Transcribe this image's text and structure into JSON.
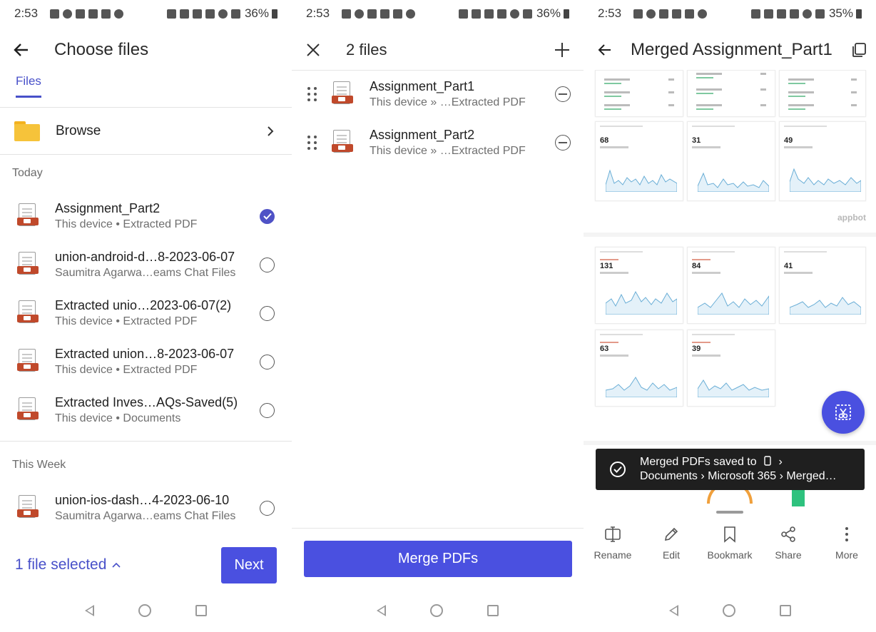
{
  "screen1": {
    "status": {
      "time": "2:53",
      "battery": "36%"
    },
    "title": "Choose files",
    "tab_files": "Files",
    "browse_label": "Browse",
    "section_today": "Today",
    "section_week": "This Week",
    "files": [
      {
        "name": "Assignment_Part2",
        "sub": "This device • Extracted PDF",
        "checked": true
      },
      {
        "name": "union-android-d…8-2023-06-07",
        "sub": "Saumitra Agarwa…eams Chat Files",
        "checked": false
      },
      {
        "name": "Extracted unio…2023-06-07(2)",
        "sub": "This device • Extracted PDF",
        "checked": false
      },
      {
        "name": "Extracted union…8-2023-06-07",
        "sub": "This device • Extracted PDF",
        "checked": false
      },
      {
        "name": "Extracted Inves…AQs-Saved(5)",
        "sub": "This device • Documents",
        "checked": false
      },
      {
        "name": "union-ios-dash…4-2023-06-10",
        "sub": "Saumitra Agarwa…eams Chat Files",
        "checked": false
      }
    ],
    "selected_text": "1 file selected",
    "next_label": "Next"
  },
  "screen2": {
    "status": {
      "time": "2:53",
      "battery": "36%"
    },
    "title": "2 files",
    "files": [
      {
        "name": "Assignment_Part1",
        "sub": "This device » …Extracted PDF"
      },
      {
        "name": "Assignment_Part2",
        "sub": "This device » …Extracted PDF"
      }
    ],
    "merge_label": "Merge PDFs"
  },
  "screen3": {
    "status": {
      "time": "2:53",
      "battery": "35%"
    },
    "title": "Merged Assignment_Part1",
    "metric_values": [
      "68",
      "31",
      "49",
      "131",
      "84",
      "41",
      "63",
      "39"
    ],
    "watermark": "appbot",
    "toast_line1": "Merged PDFs saved to",
    "toast_line2": "Documents › Microsoft 365 › Merged…",
    "actions": [
      {
        "label": "Rename",
        "icon": "rename-icon"
      },
      {
        "label": "Edit",
        "icon": "pencil-icon"
      },
      {
        "label": "Bookmark",
        "icon": "bookmark-icon"
      },
      {
        "label": "Share",
        "icon": "share-icon"
      },
      {
        "label": "More",
        "icon": "more-vertical-icon"
      }
    ]
  },
  "colors": {
    "accent": "#4a50e0",
    "link": "#4850c9",
    "pdf_red": "#c0492b",
    "folder": "#f6c33a"
  }
}
